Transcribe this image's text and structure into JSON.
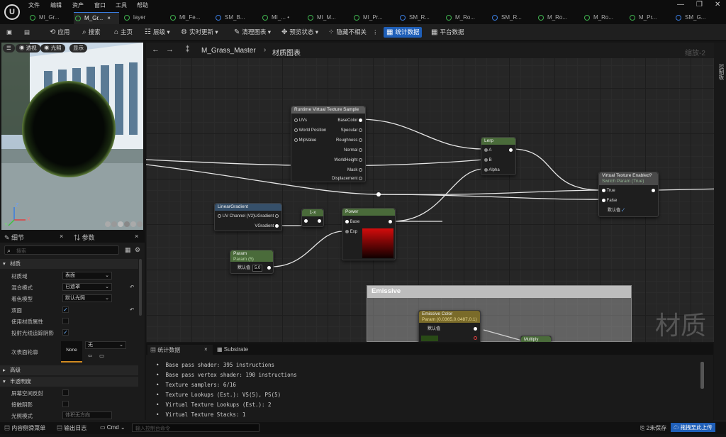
{
  "menu": [
    "文件",
    "编辑",
    "资产",
    "窗口",
    "工具",
    "帮助"
  ],
  "tabs": [
    {
      "label": "MI_Gr...",
      "active": false,
      "icon": "material-instance-icon"
    },
    {
      "label": "M_Gr...",
      "active": true,
      "icon": "material-icon",
      "close": "×"
    },
    {
      "label": "layer",
      "active": false,
      "icon": "material-instance-icon"
    },
    {
      "label": "MI_Fe...",
      "active": false,
      "icon": "material-instance-icon"
    },
    {
      "label": "SM_B...",
      "active": false,
      "icon": "static-mesh-icon"
    },
    {
      "label": "MI_...",
      "active": false,
      "icon": "material-instance-icon",
      "dirty": "•"
    },
    {
      "label": "MI_M...",
      "active": false,
      "icon": "material-instance-icon"
    },
    {
      "label": "MI_Pr...",
      "active": false,
      "icon": "material-instance-icon"
    },
    {
      "label": "SM_R...",
      "active": false,
      "icon": "static-mesh-icon"
    },
    {
      "label": "M_Ro...",
      "active": false,
      "icon": "material-icon"
    },
    {
      "label": "SM_R...",
      "active": false,
      "icon": "static-mesh-icon"
    },
    {
      "label": "M_Ro...",
      "active": false,
      "icon": "material-icon"
    },
    {
      "label": "M_Ro...",
      "active": false,
      "icon": "material-icon"
    },
    {
      "label": "M_Pr...",
      "active": false,
      "icon": "material-icon"
    },
    {
      "label": "SM_G...",
      "active": false,
      "icon": "static-mesh-icon"
    }
  ],
  "window_controls": [
    "—",
    "❐",
    "✕"
  ],
  "toolbar": {
    "apply": "应用",
    "search": "搜索",
    "home": "主页",
    "hierarchy": "层级",
    "live_update": "实时更新",
    "clean_graph": "清理图表",
    "preview_state": "预览状态",
    "hide_unrelated": "隐藏不相关",
    "stats": "统计数据",
    "platform_stats": "平台数据"
  },
  "viewport": {
    "perspective": "透视",
    "lit": "光照",
    "show": "显示",
    "axis_z": "Z",
    "axis_x": "X",
    "axis_y": "Y"
  },
  "details": {
    "tab_details": "细节",
    "tab_params": "参数",
    "search_placeholder": "搜索",
    "section_material": "材质",
    "rows": [
      {
        "label": "材质域",
        "value": "表面",
        "type": "combo"
      },
      {
        "label": "混合模式",
        "value": "已遮罩",
        "type": "combo"
      },
      {
        "label": "着色模型",
        "value": "默认光照",
        "type": "combo"
      },
      {
        "label": "双面",
        "value": "✓",
        "type": "check"
      },
      {
        "label": "使用材质属性",
        "value": "",
        "type": "check"
      },
      {
        "label": "投射光线追踪阴影",
        "value": "✓",
        "type": "check"
      }
    ],
    "subsurface_label": "次表面轮廓",
    "subsurface_thumb": "None",
    "subsurface_value": "无",
    "section_advanced": "高级",
    "section_translucency": "半透明度",
    "rows2": [
      {
        "label": "屏幕空间反射"
      },
      {
        "label": "接触阴影"
      },
      {
        "label": "光照模式",
        "value": "体积无方向"
      }
    ]
  },
  "graph": {
    "breadcrumb_name": "M_Grass_Master",
    "breadcrumb_sep": "›",
    "breadcrumb_section": "材质图表",
    "zoom": "缩放-2",
    "watermark": "材质",
    "rvt": {
      "title": "Runtime Virtual Texture Sample",
      "inputs": [
        "UVs",
        "World Position",
        "MipValue"
      ],
      "outputs": [
        "BaseColor",
        "Specular",
        "Roughness",
        "Normal",
        "WorldHeight",
        "Mask",
        "Displacement"
      ]
    },
    "lerp": {
      "title": "Lerp",
      "pins": [
        "A",
        "B",
        "Alpha"
      ]
    },
    "switch": {
      "title": "Virtual Texture Enabled?",
      "subtitle": "Switch Param (True)",
      "pins": [
        "True",
        "False"
      ],
      "default_label": "默认值"
    },
    "lineargradient": {
      "title": "LinearGradient",
      "input": "UV Channel (V2)",
      "outputs": [
        "UGradient",
        "VGradient"
      ]
    },
    "oneminus": {
      "title": "1-x"
    },
    "power": {
      "title": "Power",
      "pins": [
        "Base",
        "Exp"
      ]
    },
    "param": {
      "title": "Param",
      "subtitle": "Param (5)",
      "default_label": "默认值",
      "value": "5.0"
    },
    "emissive_comment": "Emissive",
    "emissive_color": {
      "title": "Emissive Color",
      "subtitle": "Param (0.0365,0.0487,0.1)",
      "default_label": "默认值"
    },
    "multiply": {
      "title": "Multiply"
    }
  },
  "stats_panel": {
    "tab_stats": "统计数据",
    "tab_substrate": "Substrate",
    "lines": [
      "Base pass shader: 395 instructions",
      "Base pass vertex shader: 190 instructions",
      "Texture samplers: 6/16",
      "Texture Lookups (Est.): VS(5), PS(5)",
      "Virtual Texture Lookups (Est.): 2",
      "Virtual Texture Stacks: 1"
    ]
  },
  "right_strip_label": "控制板",
  "statusbar": {
    "content_drawer": "内容侧滑菜单",
    "output_log": "输出日志",
    "cmd": "Cmd",
    "console_placeholder": "输入控制台命令",
    "unsaved": "2未保存",
    "upload": "拖拽至此上传"
  },
  "colors": {
    "accent": "#1f5fb8",
    "node_green": "#4a6b3a",
    "node_gray": "#5a5a5a",
    "emissive_header": "#7a6b2a"
  }
}
